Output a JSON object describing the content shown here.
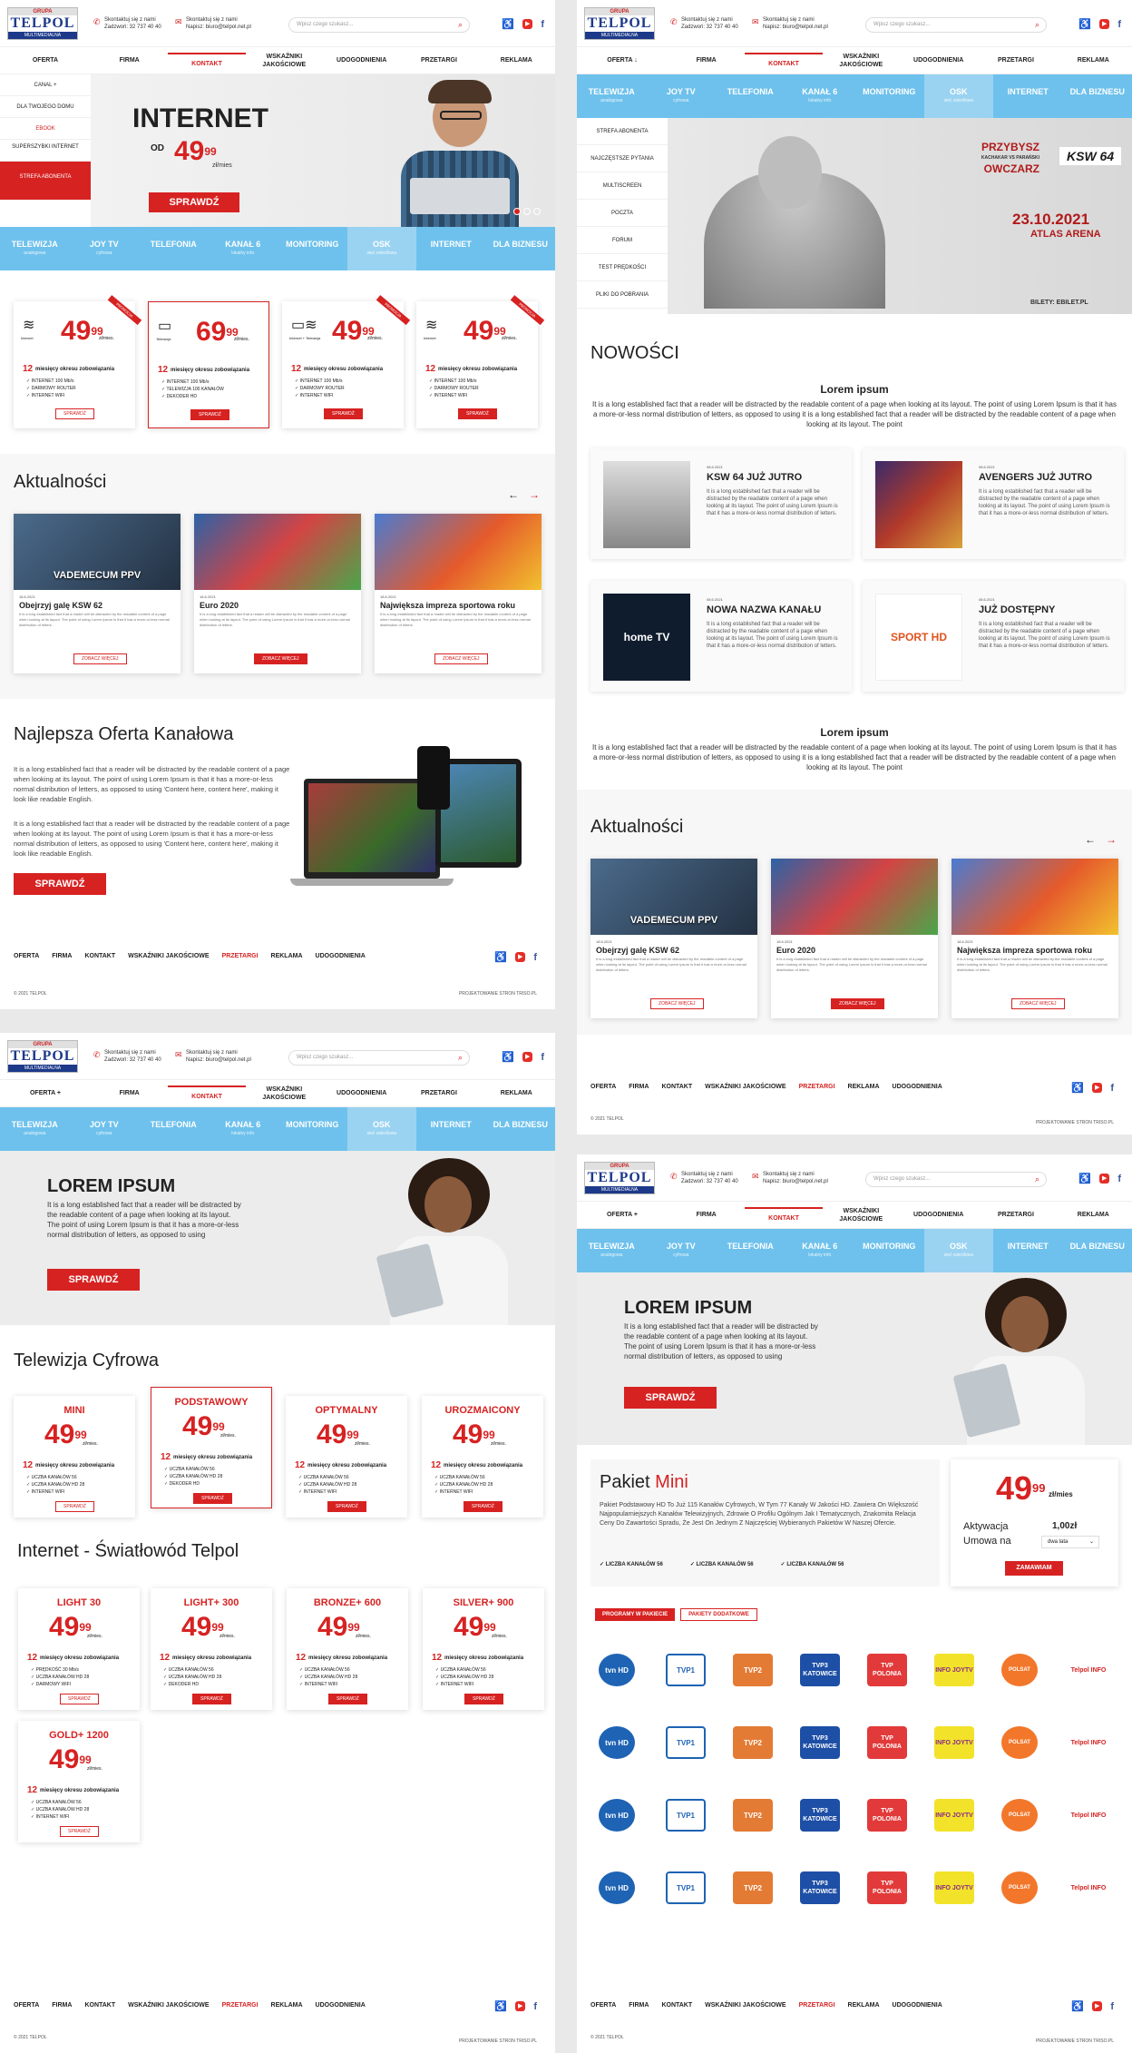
{
  "brand": {
    "logo_top": "GRUPA",
    "logo_main": "TELPOL",
    "logo_bottom": "MULTIMEDIALNA"
  },
  "header": {
    "contact1_line1": "Skontaktuj się z nami",
    "contact1_line2": "Zadzwoń: 32 737 40 40",
    "contact2_line1": "Skontaktuj się z nami",
    "contact2_line2": "Napisz: biuro@telpol.net.pl",
    "search_placeholder": "Wpisz czego szukasz..."
  },
  "menu": {
    "oferta": "OFERTA",
    "oferta_plus": "OFERTA +",
    "oferta_arrow": "OFERTA ↓",
    "items": [
      "FIRMA",
      "KONTAKT",
      "WSKAŹNIKI JAKOŚCIOWE",
      "UDOGODNIENIA",
      "PRZETARGI",
      "REKLAMA"
    ]
  },
  "categories": [
    {
      "label": "TELEWIZJA",
      "sub": "analogowa"
    },
    {
      "label": "JOY TV",
      "sub": "cyfrowa"
    },
    {
      "label": "TELEFONIA",
      "sub": ""
    },
    {
      "label": "KANAŁ 6",
      "sub": "lokalny info"
    },
    {
      "label": "MONITORING",
      "sub": ""
    },
    {
      "label": "OSK",
      "sub": "sieć osiedlowa"
    },
    {
      "label": "INTERNET",
      "sub": ""
    },
    {
      "label": "DLA BIZNESU",
      "sub": ""
    }
  ],
  "p1": {
    "side": [
      "CANAL +",
      "DLA TWOJEGO DOMU",
      "EBOOK",
      "SUPERSZYBKI INTERNET"
    ],
    "side_strefa": "STREFA ABONENTA",
    "hero_title": "INTERNET",
    "hero_od": "OD",
    "hero_price": "49",
    "hero_cents": "99",
    "hero_unit": "zł/mies",
    "hero_btn": "SPRAWDŹ",
    "cards": [
      {
        "name": "Internet",
        "price": "49",
        "cents": "99",
        "badge": "PROMOCJA",
        "items": [
          "INTERNET 100 Mb/s",
          "DARMOWY ROUTER",
          "INTERNET WIFI"
        ]
      },
      {
        "name": "Telewizja",
        "price": "69",
        "cents": "99",
        "badge": "",
        "items": [
          "INTERNET 100 Mb/s",
          "TELEWIZJA 100 KANAŁÓW",
          "DEKODER HD"
        ]
      },
      {
        "name": "Internet + Telewizja",
        "price": "49",
        "cents": "99",
        "badge": "PROMOCJA",
        "items": [
          "INTERNET 100 Mb/s",
          "DARMOWY ROUTER",
          "INTERNET WIFI"
        ]
      },
      {
        "name": "Internet",
        "price": "49",
        "cents": "99",
        "badge": "PROMOCJA",
        "items": [
          "INTERNET 100 Mb/s",
          "DARMOWY ROUTER",
          "INTERNET WIFI"
        ]
      }
    ],
    "per": "zł/mies.",
    "commit_num": "12",
    "commit_txt": "miesięcy okresu zobowiązania",
    "card_btn": "SPRAWDŹ",
    "news_title": "Aktualności",
    "news": [
      {
        "date": "18.6.2021",
        "title": "Obejrzyj galę KSW 62",
        "img_text": "VADEMECUM PPV"
      },
      {
        "date": "18.6.2021",
        "title": "Euro 2020",
        "img_text": ""
      },
      {
        "date": "18.6.2021",
        "title": "Największa impreza sportowa roku",
        "img_text": ""
      }
    ],
    "news_text": "It is a long established fact that a reader will be distracted by the readable content of a page when looking at its layout. The point of using Lorem Ipsum is that it has a more-or-less normal distribution of letters.",
    "news_btn": "ZOBACZ WIĘCEJ",
    "offer_title": "Najlepsza Oferta Kanałowa",
    "offer_p1": "It is a long established fact that a reader will be distracted by the readable content of a page when looking at its layout. The point of using Lorem Ipsum is that it has a more-or-less normal distribution of letters, as opposed to using 'Content here, content here', making it look like readable English.",
    "offer_p2": "It is a long established fact that a reader will be distracted by the readable content of a page when looking at its layout. The point of using Lorem Ipsum is that it has a more-or-less normal distribution of letters, as opposed to using 'Content here, content here', making it look like readable English.",
    "offer_btn": "SPRAWDŹ"
  },
  "footer": {
    "items": [
      "OFERTA",
      "FIRMA",
      "KONTAKT",
      "WSKAŹNIKI JAKOŚCIOWE",
      "PRZETARGI",
      "REKLAMA",
      "UDOGODNIENIA"
    ],
    "copy": "© 2021 TELPOL",
    "design": "PROJEKTOWANIE STRON TRISO.PL"
  },
  "p2": {
    "side": [
      "STREFA ABONENTA",
      "NAJCZĘSTSZE PYTANIA",
      "MULTISCREEN",
      "POCZTA",
      "FORUM",
      "TEST PRĘDKOŚCI",
      "PLIKI DO POBRANIA"
    ],
    "banner_line1": "PRZYBYSZ",
    "banner_line2": "KACHAKAR VS PARAŃSKI",
    "banner_line3": "OWCZARZ",
    "banner_ksw": "KSW 64",
    "banner_date": "23.10.2021",
    "banner_place": "ATLAS ARENA",
    "banner_tickets": "BILETY: EBILET.PL",
    "nowosci": "NOWOŚCI",
    "lorem_title": "Lorem ipsum",
    "lorem_text": "It is a long established fact that a reader will be distracted by the readable content of a page when looking at its layout. The point of using Lorem Ipsum is that it has a more-or-less normal distribution of letters, as opposed to using it is a long established fact that a reader will be distracted by the readable content of a page when looking at its layout. The point",
    "items": [
      {
        "date": "08.6.2021",
        "title": "KSW 64 JUŻ JUTRO",
        "thumb": ""
      },
      {
        "date": "08.6.2021",
        "title": "AVENGERS JUŻ JUTRO",
        "thumb": ""
      },
      {
        "date": "08.6.2021",
        "title": "NOWA NAZWA KANAŁU",
        "thumb": "home TV"
      },
      {
        "date": "08.6.2021",
        "title": "JUŻ DOSTĘPNY",
        "thumb": "SPORT HD"
      }
    ],
    "item_text": "It is a long established fact that a reader will be distracted by the readable content of a page when looking at its layout. The point of using Lorem Ipsum is that it has a more-or-less normal distribution of letters.",
    "lorem2_title": "Lorem ipsum",
    "lorem2_text": "It is a long established fact that a reader will be distracted by the readable content of a page when looking at its layout. The point of using Lorem Ipsum is that it has a more-or-less normal distribution of letters, as opposed to using it is a long established fact that a reader will be distracted by the readable content of a page when looking at its layout. The point"
  },
  "p3": {
    "hero_title": "LOREM IPSUM",
    "hero_text": "It is a long established fact that a reader will be distracted by the readable content of a page when looking at its layout. The point of using Lorem Ipsum is that it has a more-or-less normal distribution of letters, as opposed to using",
    "hero_btn": "SPRAWDŹ",
    "tv_title": "Telewizja Cyfrowa",
    "tv_cards": [
      {
        "name": "MINI",
        "items": [
          "UCZBA KANAŁÓW 56",
          "UCZBA KANAŁÓW HD 28",
          "INTERNET WIFI"
        ]
      },
      {
        "name": "PODSTAWOWY",
        "items": [
          "UCZBA KANAŁÓW 56",
          "UCZBA KANAŁÓW HD 28",
          "DEKODER HD"
        ]
      },
      {
        "name": "OPTYMALNY",
        "items": [
          "UCZBA KANAŁÓW 56",
          "UCZBA KANAŁÓW HD 28",
          "INTERNET WIFI"
        ]
      },
      {
        "name": "UROZMAICONY",
        "items": [
          "UCZBA KANAŁÓW 56",
          "UCZBA KANAŁÓW HD 28",
          "INTERNET WIFI"
        ]
      }
    ],
    "net_title": "Internet - Światłowód Telpol",
    "net_cards": [
      {
        "name": "LIGHT 30",
        "items": [
          "PRĘDKOŚĆ 30 Mb/s",
          "UCZBA KANAŁÓW HD 28",
          "DARMOWY WIFI"
        ]
      },
      {
        "name": "LIGHT+ 300",
        "items": [
          "UCZBA KANAŁÓW 56",
          "UCZBA KANAŁÓW HD 28",
          "DEKODER HD"
        ]
      },
      {
        "name": "BRONZE+ 600",
        "items": [
          "UCZBA KANAŁÓW 56",
          "UCZBA KANAŁÓW HD 28",
          "INTERNET WIFI"
        ]
      },
      {
        "name": "SILVER+ 900",
        "items": [
          "UCZBA KANAŁÓW 56",
          "UCZBA KANAŁÓW HD 28",
          "INTERNET WIFI"
        ]
      },
      {
        "name": "GOLD+ 1200",
        "items": [
          "UCZBA KANAŁÓW 56",
          "UCZBA KANAŁÓW HD 28",
          "INTERNET WIFI"
        ]
      }
    ]
  },
  "p4": {
    "hero_title": "LOREM IPSUM",
    "hero_text": "It is a long established fact that a reader will be distracted by the readable content of a page when looking at its layout. The point of using Lorem Ipsum is that it has a more-or-less normal distribution of letters, as opposed to using",
    "hero_btn": "SPRAWDŹ",
    "pakiet_label": "Pakiet",
    "pakiet_name": "Mini",
    "pakiet_text": "Pakiet Podstawowy HD To Już 115 Kanałów Cyfrowych, W Tym 77 Kanały W Jakości HD. Zawiera On Większość Najpopularniejszych Kanałów Telewizyjnych, Zdrowie O Profilu Ogólnym Jak I Tematycznych, Znakomita Relacja Ceny Do Zawartości Spradu, Że Jest On Jednym Z Najczęściej Wybieranych Pakietów W Naszej Ofercie.",
    "features": [
      "LICZBA KANAŁÓW 56",
      "LICZBA KANAŁÓW 56",
      "LICZBA KANAŁÓW 56"
    ],
    "price": "49",
    "cents": "99",
    "unit": "zł/mies",
    "aktywacja": "Aktywacja",
    "aktywacja_val": "1,00zł",
    "umowa": "Umowa na",
    "umowa_val": "dwa lata",
    "order_btn": "ZAMAWIAM",
    "tab1": "PROGRAMY W PAKIECIE",
    "tab2": "PAKIETY DODATKOWE",
    "channels": [
      "tvn HD",
      "TVP1",
      "TVP2",
      "TVP3 KATOWICE",
      "TVP POLONIA",
      "INFO JOYTV",
      "POLSAT",
      "Telpol INFO"
    ]
  },
  "colors": {
    "red": "#d72222",
    "blue": "#6ec1ec",
    "navy": "#1d3a8a"
  }
}
